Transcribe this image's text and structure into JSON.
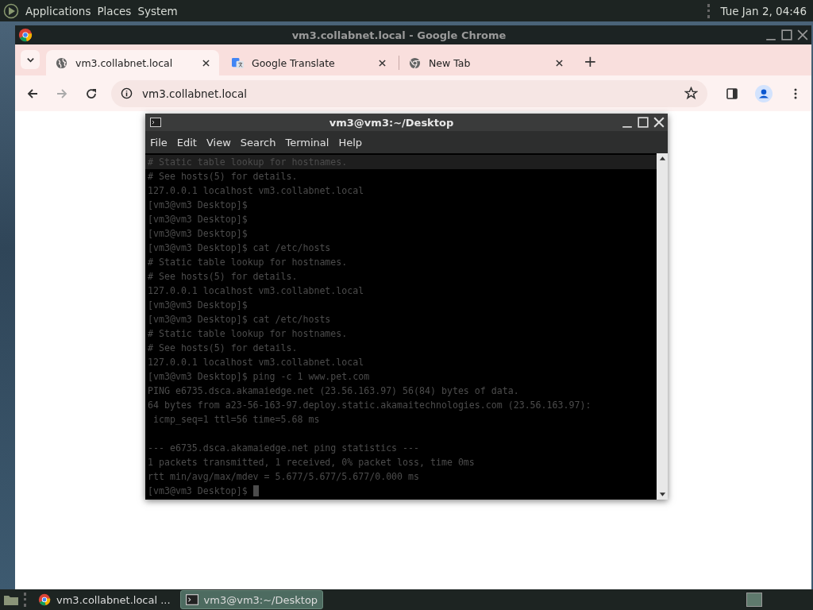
{
  "top_panel": {
    "menus": [
      "Applications",
      "Places",
      "System"
    ],
    "clock": "Tue Jan  2, 04:46"
  },
  "browser": {
    "window_title": "vm3.collabnet.local - Google Chrome",
    "tabs": [
      {
        "title": "vm3.collabnet.local",
        "selected": true
      },
      {
        "title": "Google Translate",
        "selected": false
      },
      {
        "title": "New Tab",
        "selected": false
      }
    ],
    "new_tab": "+",
    "address": "vm3.collabnet.local"
  },
  "terminal": {
    "title": "vm3@vm3:~/Desktop",
    "menus": [
      "File",
      "Edit",
      "View",
      "Search",
      "Terminal",
      "Help"
    ],
    "lines": [
      {
        "text": "# Static table lookup for hostnames.",
        "selected": true
      },
      {
        "text": "# See hosts(5) for details.",
        "selected": false
      },
      {
        "text": "127.0.0.1 localhost vm3.collabnet.local",
        "selected": false
      },
      {
        "text": "[vm3@vm3 Desktop]$",
        "selected": false
      },
      {
        "text": "[vm3@vm3 Desktop]$",
        "selected": false
      },
      {
        "text": "[vm3@vm3 Desktop]$",
        "selected": false
      },
      {
        "text": "[vm3@vm3 Desktop]$ cat /etc/hosts",
        "selected": false
      },
      {
        "text": "# Static table lookup for hostnames.",
        "selected": false
      },
      {
        "text": "# See hosts(5) for details.",
        "selected": false
      },
      {
        "text": "127.0.0.1 localhost vm3.collabnet.local",
        "selected": false
      },
      {
        "text": "[vm3@vm3 Desktop]$",
        "selected": false
      },
      {
        "text": "[vm3@vm3 Desktop]$ cat /etc/hosts",
        "selected": false
      },
      {
        "text": "# Static table lookup for hostnames.",
        "selected": false
      },
      {
        "text": "# See hosts(5) for details.",
        "selected": false
      },
      {
        "text": "127.0.0.1 localhost vm3.collabnet.local",
        "selected": false
      },
      {
        "text": "[vm3@vm3 Desktop]$ ping -c 1 www.pet.com",
        "selected": false
      },
      {
        "text": "PING e6735.dsca.akamaiedge.net (23.56.163.97) 56(84) bytes of data.",
        "selected": false
      },
      {
        "text": "64 bytes from a23-56-163-97.deploy.static.akamaitechnologies.com (23.56.163.97):",
        "selected": false
      },
      {
        "text": " icmp_seq=1 ttl=56 time=5.68 ms",
        "selected": false
      },
      {
        "selected": false
      },
      {
        "text": "--- e6735.dsca.akamaiedge.net ping statistics ---",
        "selected": false
      },
      {
        "text": "1 packets transmitted, 1 received, 0% packet loss, time 0ms",
        "selected": false
      },
      {
        "text": "rtt min/avg/max/mdev = 5.677/5.677/5.677/0.000 ms",
        "selected": false
      },
      {
        "text": "[vm3@vm3 Desktop]$ ",
        "selected": false
      }
    ]
  },
  "taskbar": {
    "items": [
      {
        "label": "vm3.collabnet.local ...",
        "selected": false
      },
      {
        "label": "vm3@vm3:~/Desktop",
        "selected": true
      }
    ]
  }
}
